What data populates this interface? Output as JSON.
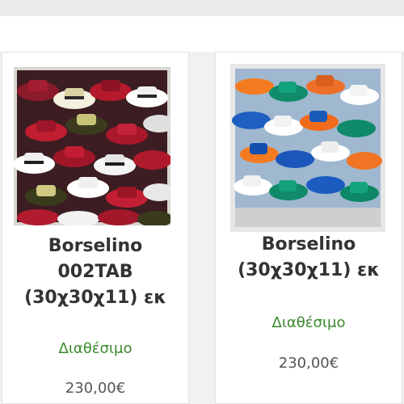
{
  "products": [
    {
      "title_lines": [
        "Borselino",
        "002TAB",
        "(30χ30χ11) εκ"
      ],
      "availability": "Διαθέσιμο",
      "price": "230,00€",
      "image_icon": "hat-artwork-image"
    },
    {
      "title_lines": [
        "Borselino",
        "(30χ30χ11) εκ"
      ],
      "availability": "Διαθέσιμο",
      "price": "230,00€",
      "image_icon": "hat-artwork-image"
    }
  ],
  "colors": {
    "availability": "#3a8a2c",
    "price": "#555555",
    "title": "#333333"
  }
}
